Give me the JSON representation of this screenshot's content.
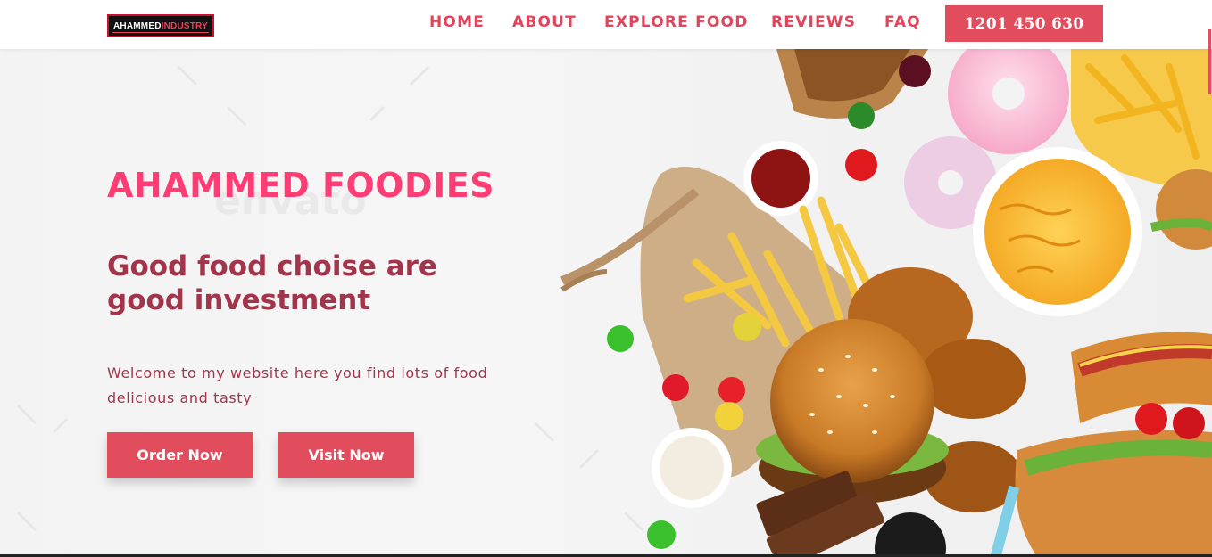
{
  "header": {
    "logo": {
      "text_a": "AHAMMED",
      "text_b": "INDUSTRY"
    },
    "nav": [
      {
        "label": "HOME"
      },
      {
        "label": "ABOUT"
      },
      {
        "label": "EXPLORE FOOD"
      },
      {
        "label": "REVIEWS"
      },
      {
        "label": "FAQ"
      }
    ],
    "phone_label": "1201 450 630"
  },
  "hero": {
    "title": "AHAMMED FOODIES",
    "subtitle": "Good food choise are good investment",
    "description": "Welcome to my website here you find lots of food delicious and tasty",
    "buttons": {
      "order": "Order Now",
      "visit": "Visit Now"
    }
  },
  "colors": {
    "accent": "#e24d5e",
    "title_pink": "#ff3d75",
    "text_maroon": "#a2354b",
    "nav_red": "#e0455b"
  }
}
